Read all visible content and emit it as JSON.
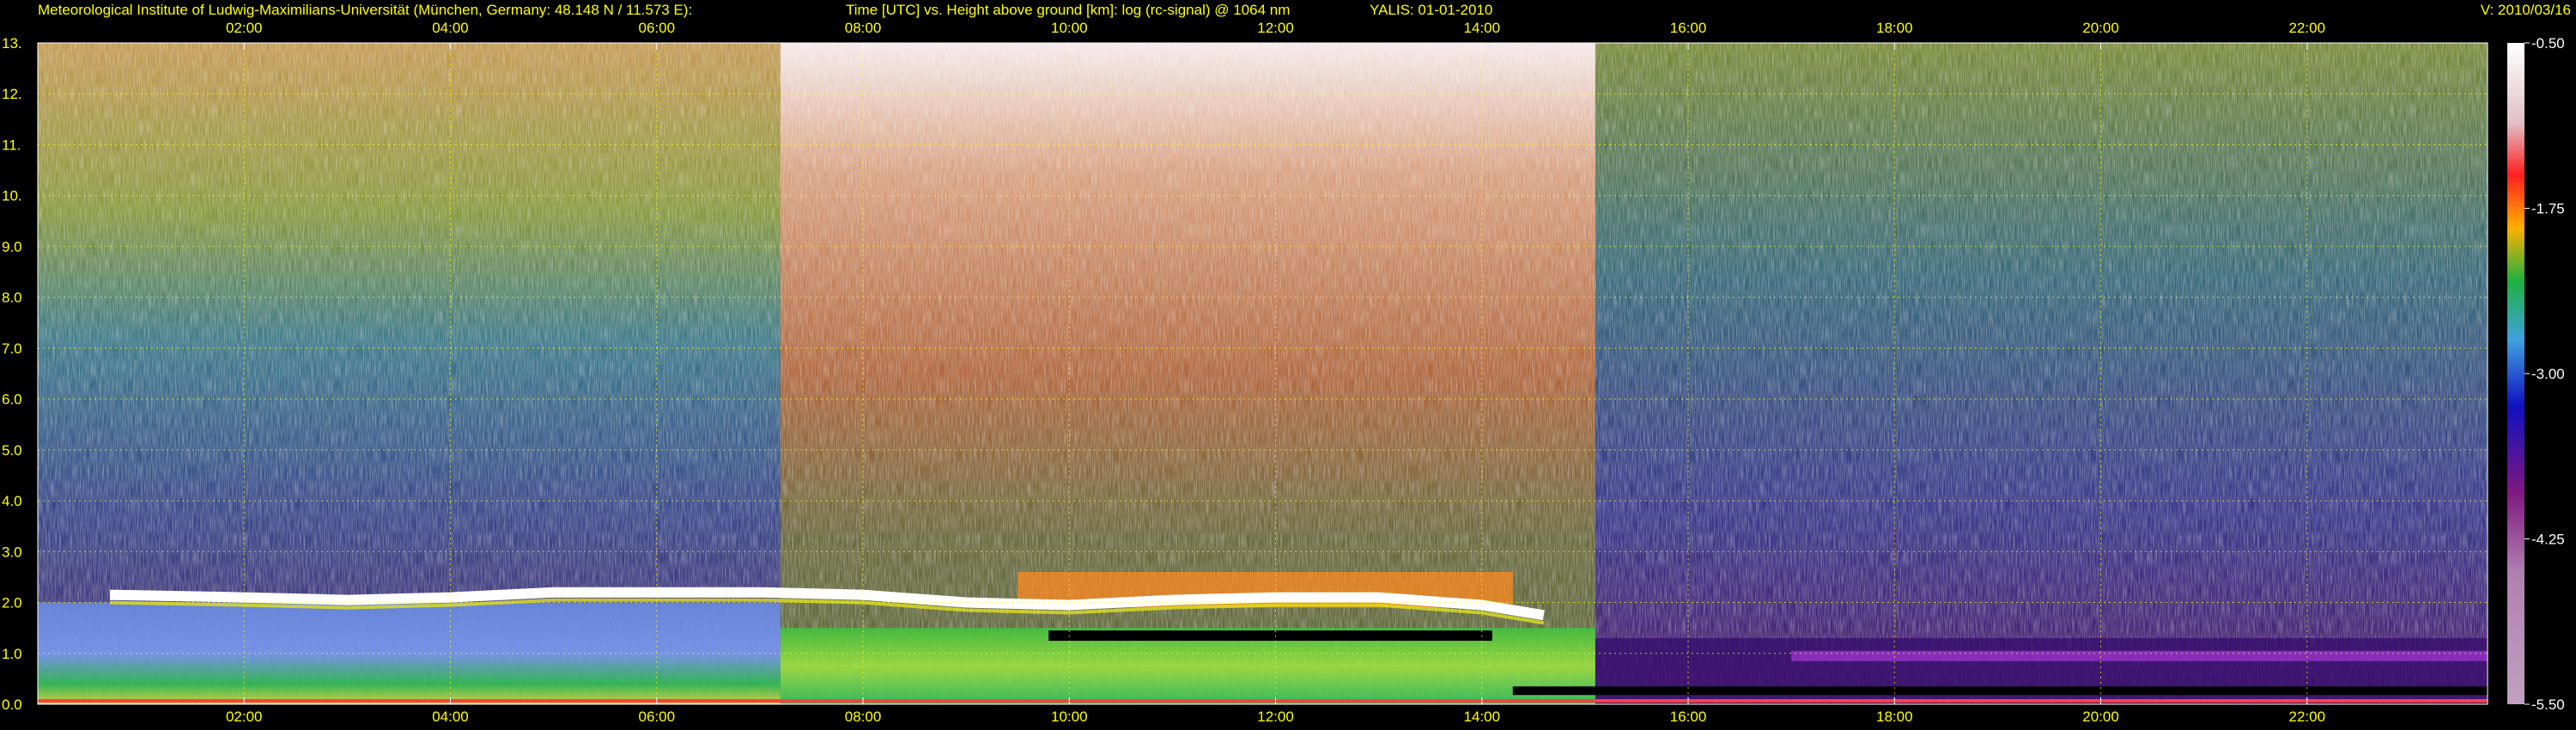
{
  "header": {
    "institute": "Meteorological Institute of Ludwig-Maximilians-Universität (München, Germany: 48.148 N / 11.573 E):",
    "plot_title": "Time [UTC] vs. Height above ground [km]: log (rc-signal) @ 1064 nm",
    "instrument_date": "YALIS: 01-01-2010",
    "version": "V: 2010/03/16"
  },
  "colors": {
    "background": "#000000",
    "text": "#ffff00",
    "grid": "#ffff00"
  },
  "chart_data": {
    "type": "heatmap",
    "title": "Time [UTC] vs. Height above ground [km]: log (rc-signal) @ 1064 nm",
    "xlabel": "Time [UTC]",
    "ylabel": "Height above ground [km]",
    "x_ticks": [
      "02:00",
      "04:00",
      "06:00",
      "08:00",
      "10:00",
      "12:00",
      "14:00",
      "16:00",
      "18:00",
      "20:00",
      "22:00"
    ],
    "x_tick_hours": [
      2,
      4,
      6,
      8,
      10,
      12,
      14,
      16,
      18,
      20,
      22
    ],
    "xlim_hours": [
      0,
      23.75
    ],
    "y_ticks": [
      "0.0",
      "1.0",
      "2.0",
      "3.0",
      "4.0",
      "5.0",
      "6.0",
      "7.0",
      "8.0",
      "9.0",
      "10.",
      "11.",
      "12.",
      "13."
    ],
    "y_tick_values": [
      0,
      1,
      2,
      3,
      4,
      5,
      6,
      7,
      8,
      9,
      10,
      11,
      12,
      13
    ],
    "ylim_km": [
      0,
      13
    ],
    "grid": true,
    "colorbar": {
      "ticks": [
        "-0.50",
        "-1.75",
        "-3.00",
        "-4.25",
        "-5.50"
      ],
      "tick_values": [
        -0.5,
        -1.75,
        -3.0,
        -4.25,
        -5.5
      ],
      "range": [
        -5.5,
        -0.5
      ]
    }
  }
}
